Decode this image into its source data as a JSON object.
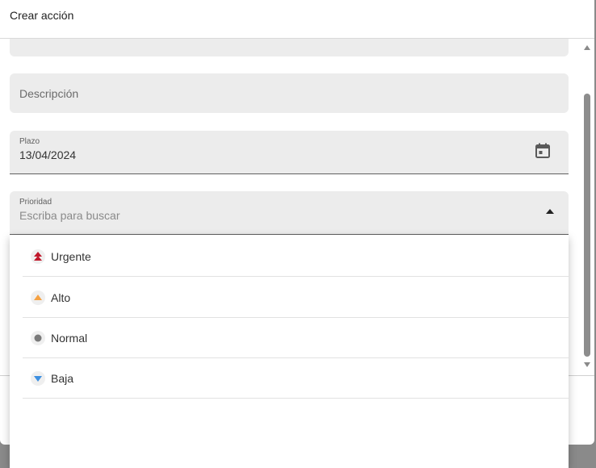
{
  "dialog": {
    "title": "Crear acción"
  },
  "fields": {
    "description": {
      "placeholder": "Descripción"
    },
    "plazo": {
      "label": "Plazo",
      "value": "13/04/2024",
      "icon": "calendar-icon"
    },
    "prioridad": {
      "label": "Prioridad",
      "placeholder": "Escriba para buscar",
      "icon": "caret-up-icon"
    }
  },
  "priority_options": [
    {
      "label": "Urgente",
      "icon": "double-arrow-up-icon",
      "color": "#c0182b"
    },
    {
      "label": "Alto",
      "icon": "triangle-up-icon",
      "color": "#f5a142"
    },
    {
      "label": "Normal",
      "icon": "circle-icon",
      "color": "#7a7a7a"
    },
    {
      "label": "Baja",
      "icon": "triangle-down-icon",
      "color": "#3d8fe0"
    }
  ]
}
